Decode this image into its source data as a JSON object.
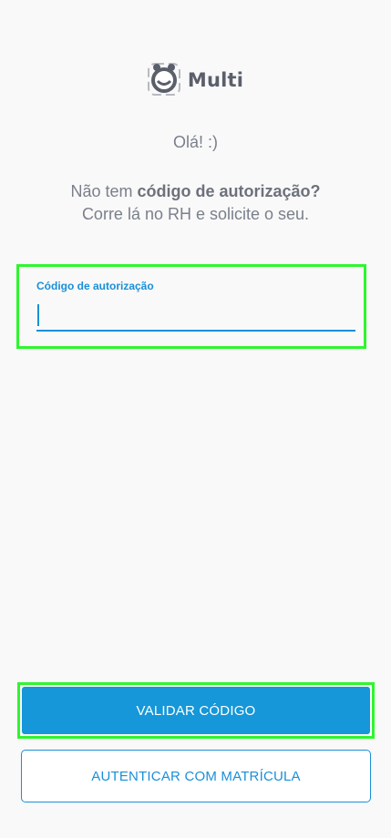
{
  "logo": {
    "text": "Multi"
  },
  "greeting": "Olá! :)",
  "hint": {
    "prefix": "Não tem ",
    "bold": "código de autorização?",
    "line2": "Corre lá no RH e solicite o seu."
  },
  "auth_field": {
    "label": "Código de autorização",
    "value": "",
    "placeholder": ""
  },
  "buttons": {
    "validate": "VALIDAR CÓDIGO",
    "matricula": "AUTENTICAR COM MATRÍCULA"
  },
  "colors": {
    "accent": "#1597d9",
    "highlight": "#2ff52f",
    "text_muted": "#7a7f8b"
  },
  "icons": {
    "logo_icon": "multi-logo-icon"
  }
}
